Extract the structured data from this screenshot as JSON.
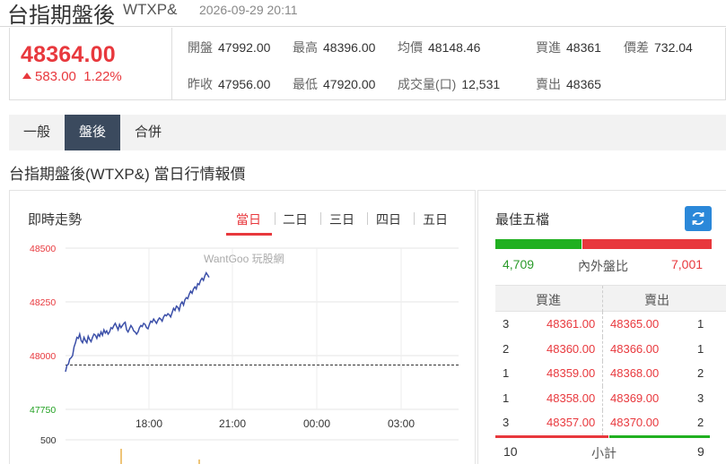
{
  "header": {
    "title": "台指期盤後",
    "code": "WTXP&",
    "datetime": "2026-09-29 20:11"
  },
  "quote": {
    "price": "48364.00",
    "change": "583.00",
    "change_pct": "1.22%",
    "direction": "up",
    "fields": {
      "open": {
        "label": "開盤",
        "value": "47992.00"
      },
      "high": {
        "label": "最高",
        "value": "48396.00"
      },
      "avg": {
        "label": "均價",
        "value": "48148.46"
      },
      "bid": {
        "label": "買進",
        "value": "48361"
      },
      "spread": {
        "label": "價差",
        "value": "732.04"
      },
      "prev_close": {
        "label": "昨收",
        "value": "47956.00"
      },
      "low": {
        "label": "最低",
        "value": "47920.00"
      },
      "volume": {
        "label": "成交量(口)",
        "value": "12,531"
      },
      "ask": {
        "label": "賣出",
        "value": "48365"
      }
    }
  },
  "tabs": [
    {
      "label": "一般",
      "active": false
    },
    {
      "label": "盤後",
      "active": true
    },
    {
      "label": "合併",
      "active": false
    }
  ],
  "section_title": "台指期盤後(WTXP&) 當日行情報價",
  "intraday": {
    "title": "即時走勢",
    "watermark": "WantGoo 玩股網",
    "day_tabs": [
      {
        "label": "當日",
        "active": true
      },
      {
        "label": "二日",
        "active": false
      },
      {
        "label": "三日",
        "active": false
      },
      {
        "label": "四日",
        "active": false
      },
      {
        "label": "五日",
        "active": false
      }
    ]
  },
  "chart_data": {
    "type": "line",
    "title": "即時走勢",
    "xlabel": "",
    "ylabel": "",
    "ylim": [
      47750,
      48500
    ],
    "y_ticks": [
      "48500",
      "48250",
      "48000",
      "47750"
    ],
    "x_ticks": [
      "18:00",
      "21:00",
      "00:00",
      "03:00"
    ],
    "reference_line": 47956,
    "grid": true,
    "series": [
      {
        "values": [
          47925,
          47955,
          47960,
          47985,
          47990,
          48000,
          48040,
          48060,
          48085,
          48080,
          48100,
          48070,
          48060,
          48085,
          48070,
          48060,
          48090,
          48075,
          48065,
          48085,
          48100,
          48095,
          48080,
          48100,
          48090,
          48110,
          48095,
          48120,
          48105,
          48115,
          48100,
          48110,
          48130,
          48125,
          48140,
          48150,
          48135,
          48120,
          48145,
          48130,
          48140,
          48150,
          48155,
          48120,
          48110,
          48125,
          48140,
          48130,
          48115,
          48110,
          48100,
          48110,
          48130,
          48140,
          48135,
          48150,
          48145,
          48130,
          48125,
          48145,
          48160,
          48155,
          48170,
          48160,
          48150,
          48165,
          48175,
          48170,
          48160,
          48180,
          48190,
          48185,
          48195,
          48190,
          48180,
          48200,
          48220,
          48210,
          48230,
          48225,
          48210,
          48240,
          48250,
          48235,
          48260,
          48270,
          48265,
          48285,
          48300,
          48290,
          48310,
          48320,
          48310,
          48335,
          48330,
          48350,
          48360,
          48350,
          48370,
          48385,
          48375,
          48364
        ]
      }
    ],
    "volume_axis": {
      "ticks": [
        "500"
      ]
    }
  },
  "order_book": {
    "title": "最佳五檔",
    "inner_volume": "4,709",
    "ratio_label": "內外盤比",
    "outer_volume": "7,001",
    "inner_ratio": 0.402,
    "bid_header": "買進",
    "ask_header": "賣出",
    "rows": [
      {
        "bid_qty": "3",
        "bid_price": "48361.00",
        "ask_price": "48365.00",
        "ask_qty": "1"
      },
      {
        "bid_qty": "2",
        "bid_price": "48360.00",
        "ask_price": "48366.00",
        "ask_qty": "1"
      },
      {
        "bid_qty": "1",
        "bid_price": "48359.00",
        "ask_price": "48368.00",
        "ask_qty": "2"
      },
      {
        "bid_qty": "1",
        "bid_price": "48358.00",
        "ask_price": "48369.00",
        "ask_qty": "3"
      },
      {
        "bid_qty": "3",
        "bid_price": "48357.00",
        "ask_price": "48370.00",
        "ask_qty": "2"
      }
    ],
    "subtotal_label": "小計",
    "bid_total": "10",
    "ask_total": "9"
  },
  "colors": {
    "up": "#e8383d",
    "down": "#20b020",
    "accent_button": "#2b88d9",
    "tab_active": "#3b4a5e",
    "line": "#3b4fa8"
  }
}
